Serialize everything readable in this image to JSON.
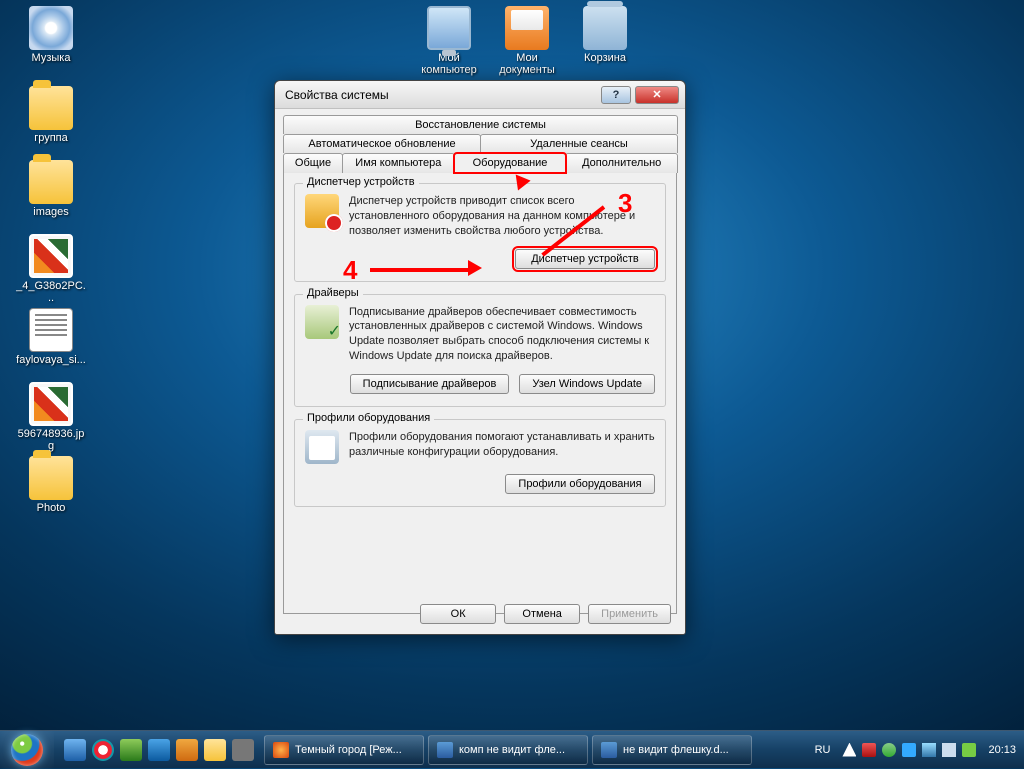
{
  "desktop_icons": {
    "music": "Музыка",
    "my_computer": "Мой\nкомпьютер",
    "my_documents": "Мои\nдокументы",
    "recycle_bin": "Корзина",
    "group": "группа",
    "images": "images",
    "file1": "_4_G38o2PC...",
    "file2": "faylovaya_si...",
    "file3": "596748936.jpg",
    "photo": "Photo"
  },
  "dialog": {
    "title": "Свойства системы",
    "tabs_row1": [
      "Восстановление системы"
    ],
    "tabs_row2": [
      "Автоматическое обновление",
      "Удаленные сеансы"
    ],
    "tabs_row3": [
      "Общие",
      "Имя компьютера",
      "Оборудование",
      "Дополнительно"
    ],
    "active_tab_index": 2,
    "group1": {
      "legend": "Диспетчер устройств",
      "text": "Диспетчер устройств приводит список всего установленного оборудования на данном компьютере и позволяет изменить свойства любого устройства.",
      "button": "Диспетчер устройств"
    },
    "group2": {
      "legend": "Драйверы",
      "text": "Подписывание драйверов обеспечивает совместимость установленных драйверов с системой Windows.  Windows Update позволяет выбрать способ подключения системы к Windows Update для поиска драйверов.",
      "button1": "Подписывание драйверов",
      "button2": "Узел Windows Update"
    },
    "group3": {
      "legend": "Профили оборудования",
      "text": "Профили оборудования помогают устанавливать и хранить различные конфигурации оборудования.",
      "button": "Профили оборудования"
    },
    "footer": {
      "ok": "ОК",
      "cancel": "Отмена",
      "apply": "Применить"
    }
  },
  "annotations": {
    "n3": "3",
    "n4": "4"
  },
  "taskbar": {
    "items": [
      {
        "label": "Темный город [Реж..."
      },
      {
        "label": "комп не видит фле..."
      },
      {
        "label": "не видит флешку.d..."
      }
    ],
    "lang": "RU",
    "clock": "20:13"
  },
  "colors": {
    "accent_red": "#f00"
  }
}
